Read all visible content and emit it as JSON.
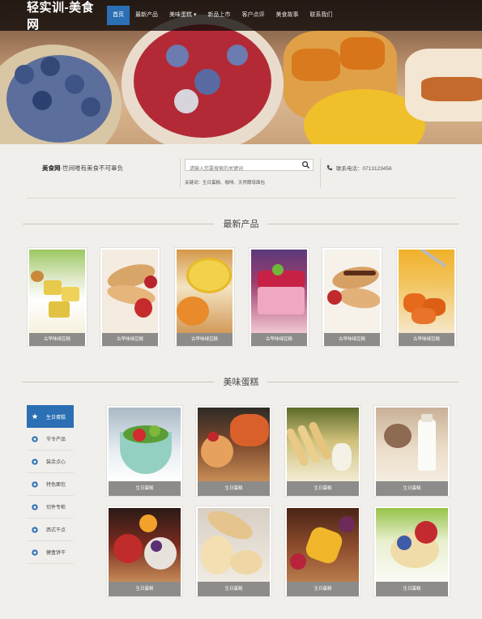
{
  "site": {
    "logo": "轻实训-美食网"
  },
  "nav": [
    {
      "label": "首页",
      "active": true
    },
    {
      "label": "最新产品",
      "active": false
    },
    {
      "label": "美味蛋糕 ▾",
      "active": false
    },
    {
      "label": "新品上市",
      "active": false
    },
    {
      "label": "客户点评",
      "active": false
    },
    {
      "label": "美食故事",
      "active": false
    },
    {
      "label": "联系我们",
      "active": false
    }
  ],
  "info": {
    "tagline_brand": "美食网",
    "tagline_text": "-世间唯有美食不可辜负",
    "search_placeholder": "请输入您要搜索的关键词",
    "keywords": "关键词：生日蛋糕、咖啡、天然酵母面包",
    "phone": "联系电话：0713123456"
  },
  "latest": {
    "title": "最新产品",
    "items": [
      {
        "caption": "古早味绿豆糕",
        "icon": "mung-bean-cake-icon"
      },
      {
        "caption": "古早味绿豆糕",
        "icon": "crepe-icon"
      },
      {
        "caption": "古早味绿豆糕",
        "icon": "lemon-icon"
      },
      {
        "caption": "古早味绿豆糕",
        "icon": "mousse-cake-icon"
      },
      {
        "caption": "古早味绿豆糕",
        "icon": "crepe-icon"
      },
      {
        "caption": "古早味绿豆糕",
        "icon": "fried-food-icon"
      }
    ]
  },
  "cakes": {
    "title": "美味蛋糕",
    "sidebar": [
      {
        "label": "生日蛋糕",
        "active": true
      },
      {
        "label": "节令产品",
        "active": false
      },
      {
        "label": "装余点心",
        "active": false
      },
      {
        "label": "特色面包",
        "active": false
      },
      {
        "label": "切件专柜",
        "active": false
      },
      {
        "label": "西式干点",
        "active": false
      },
      {
        "label": "健盒饼干",
        "active": false
      }
    ],
    "items": [
      {
        "caption": "生日蛋糕",
        "icon": "fruit-salad-icon"
      },
      {
        "caption": "生日蛋糕",
        "icon": "dessert-plate-icon"
      },
      {
        "caption": "生日蛋糕",
        "icon": "sponge-fingers-icon"
      },
      {
        "caption": "生日蛋糕",
        "icon": "milk-bottle-icon"
      },
      {
        "caption": "生日蛋糕",
        "icon": "fruit-tart-icon"
      },
      {
        "caption": "生日蛋糕",
        "icon": "bread-icon"
      },
      {
        "caption": "生日蛋糕",
        "icon": "mango-platter-icon"
      },
      {
        "caption": "生日蛋糕",
        "icon": "fruit-tart-icon"
      }
    ]
  },
  "colors": {
    "accent": "#2b6fb4",
    "caption_bg": "#8d8c8a",
    "page_bg": "#f1efec"
  }
}
